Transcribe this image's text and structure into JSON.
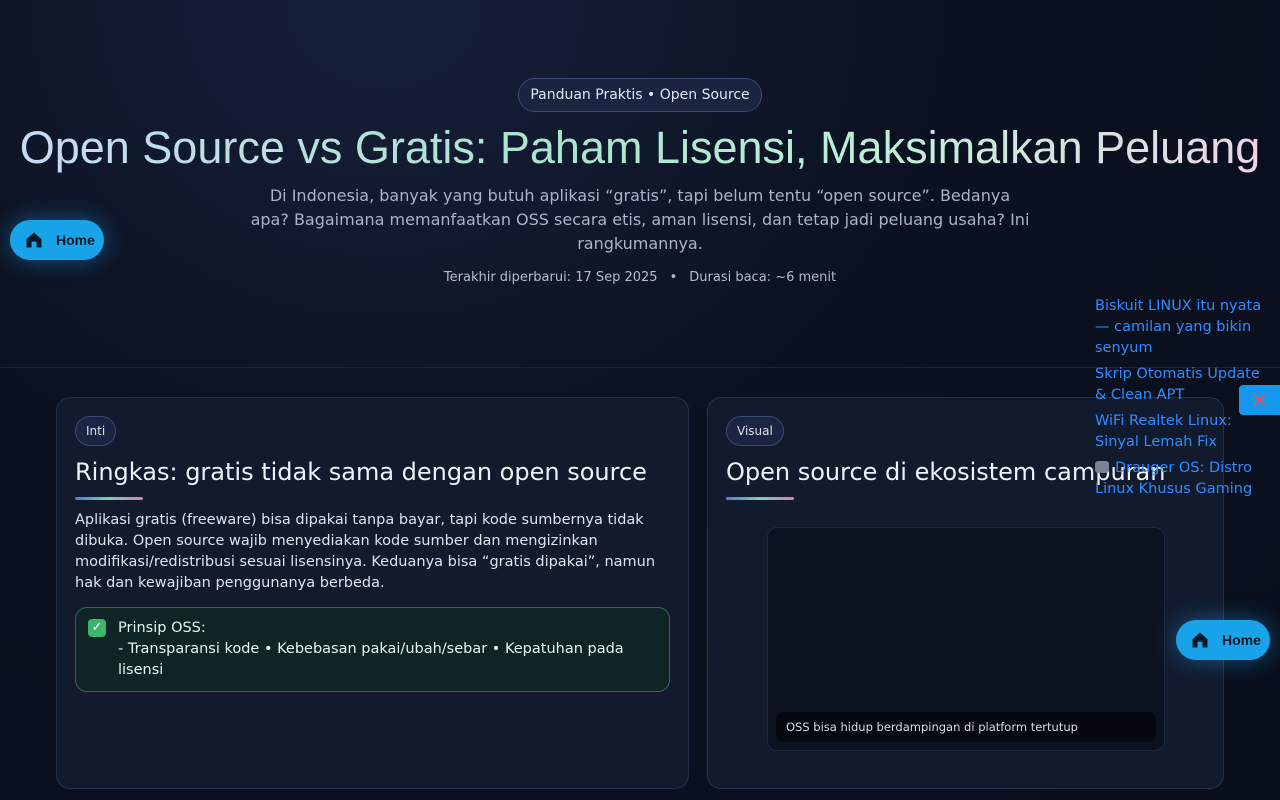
{
  "hero": {
    "badge": "Panduan Praktis • Open Source",
    "title": "Open Source vs Gratis: Paham Lisensi, Maksimalkan Peluang",
    "subtitle": "Di Indonesia, banyak yang butuh aplikasi “gratis”, tapi belum tentu “open source”. Bedanya apa? Bagaimana memanfaatkan OSS secara etis, aman lisensi, dan tetap jadi peluang usaha? Ini rangkumannya.",
    "updated": "Terakhir diperbarui: 17 Sep 2025",
    "read_time": "Durasi baca: ~6 menit"
  },
  "home_button": {
    "label": "Home",
    "icon": "home-icon"
  },
  "card_left": {
    "tag": "Inti",
    "title": "Ringkas: gratis tidak sama dengan open source",
    "text": "Aplikasi gratis (freeware) bisa dipakai tanpa bayar, tapi kode sumbernya tidak dibuka. Open source wajib menyediakan kode sumber dan mengizinkan modifikasi/redistribusi sesuai lisensinya. Keduanya bisa “gratis dipakai”, namun hak dan kewajiban penggunanya berbeda.",
    "note_title": "Prinsip OSS:",
    "note_body": "- Transparansi kode • Kebebasan pakai/ubah/sebar • Kepatuhan pada lisensi"
  },
  "card_right": {
    "tag": "Visual",
    "title": "Open source di ekosistem campuran",
    "caption": "OSS bisa hidup berdampingan di platform tertutup"
  },
  "side_links": [
    "Biskuit LINUX itu nyata — camilan yang bikin senyum",
    "Skrip Otomatis Update & Clean APT",
    "WiFi Realtek Linux: Sinyal Lemah Fix",
    "Drauger OS: Distro Linux Khusus Gaming"
  ],
  "close_button": {
    "label": "✕",
    "icon": "close-icon"
  },
  "colors": {
    "accent": "#19a4ea",
    "link": "#2f8cff",
    "background": "#0b1120"
  }
}
